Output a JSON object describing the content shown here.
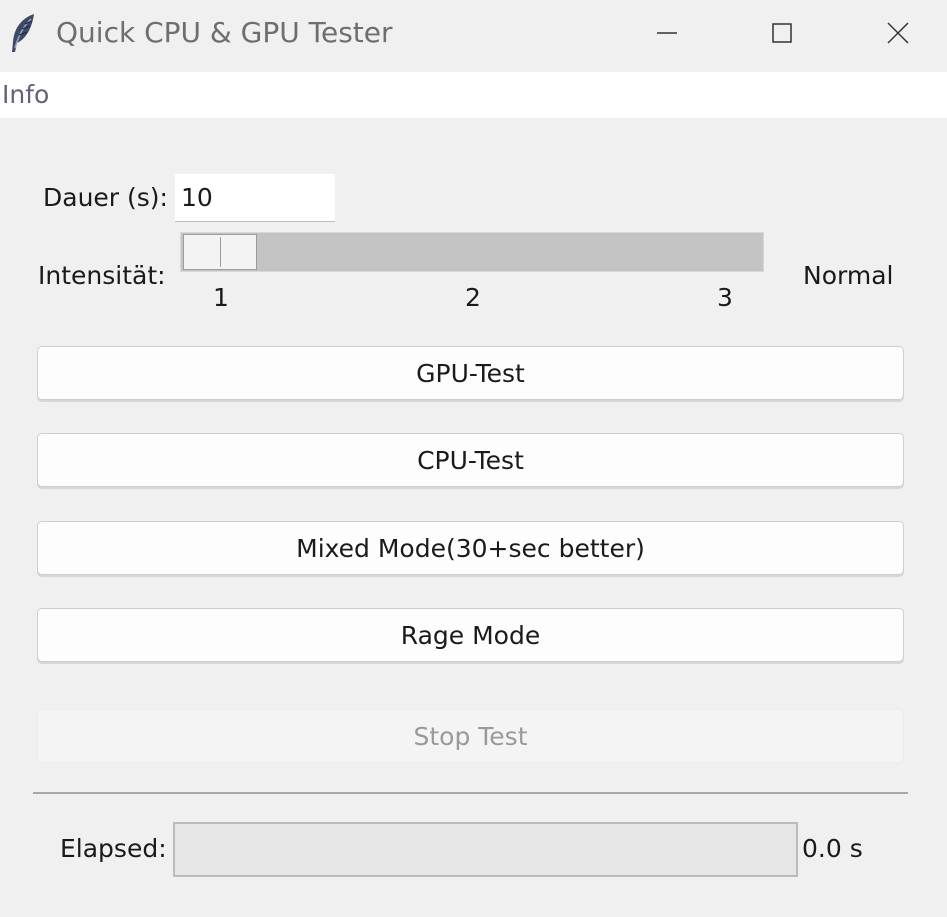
{
  "window": {
    "title": "Quick CPU & GPU Tester",
    "icon": "feather-icon",
    "controls": [
      "minimize-icon",
      "maximize-icon",
      "close-icon"
    ]
  },
  "menubar": {
    "items": [
      {
        "label": "Info"
      }
    ]
  },
  "duration": {
    "label": "Dauer (s):",
    "value": "10"
  },
  "intensity": {
    "label": "Intensität:",
    "ticks": [
      "1",
      "2",
      "3"
    ],
    "value": 1,
    "value_label": "Normal"
  },
  "buttons": {
    "gpu": "GPU-Test",
    "cpu": "CPU-Test",
    "mixed": "Mixed Mode(30+sec better)",
    "rage": "Rage Mode",
    "stop": "Stop Test"
  },
  "elapsed": {
    "label": "Elapsed:",
    "progress": 0,
    "value": "0.0 s"
  },
  "colors": {
    "background": "#f0f0f0",
    "menu_text": "#6a5f78",
    "title_text": "#6e6e6e",
    "disabled_text": "#9a9a9a"
  }
}
